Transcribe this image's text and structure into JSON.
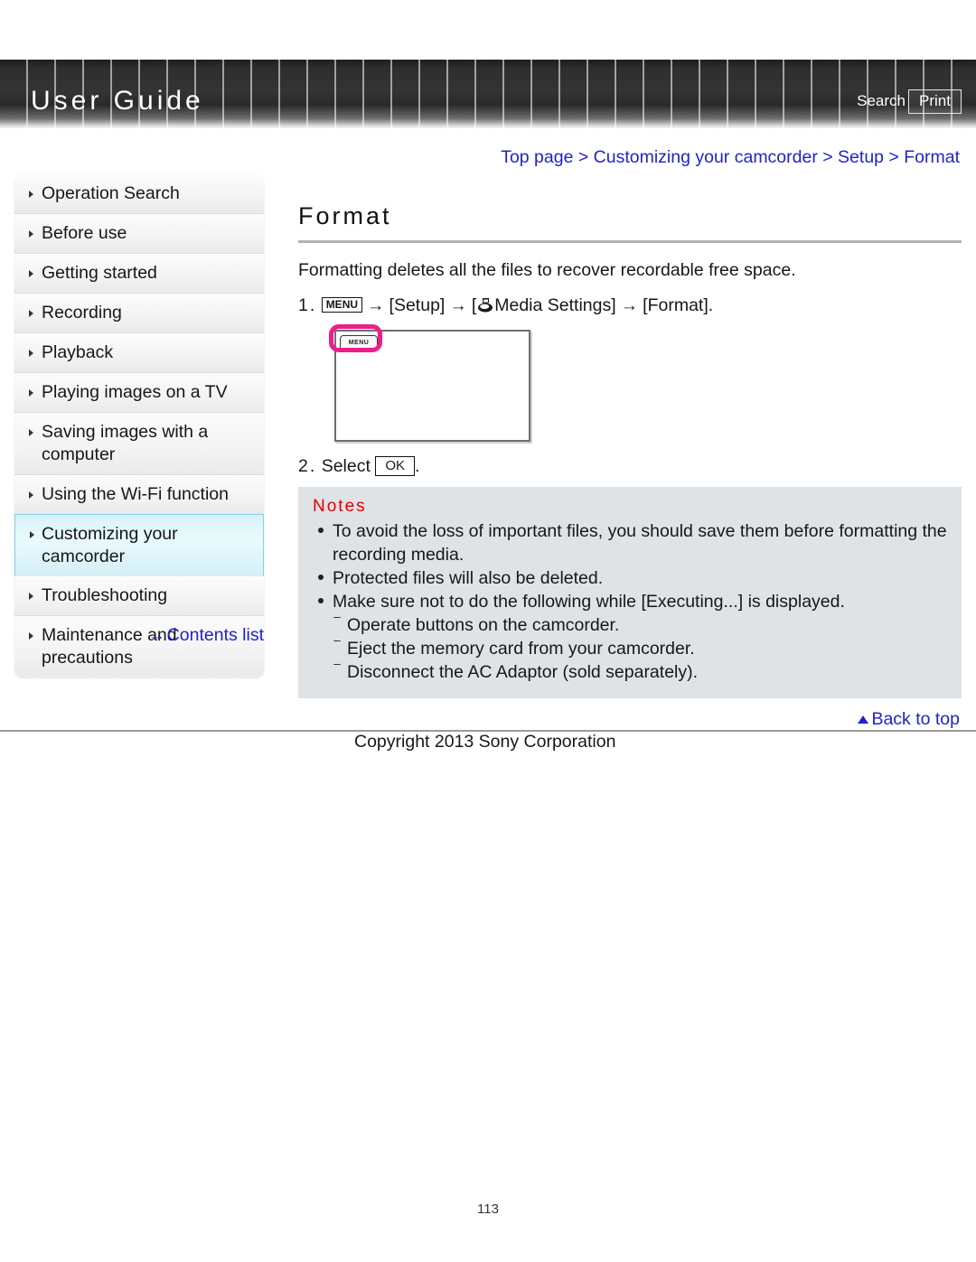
{
  "header": {
    "title": "User Guide",
    "search_label": "Search",
    "print_label": "Print"
  },
  "breadcrumb": {
    "text": "Top page > Customizing your camcorder > Setup > Format"
  },
  "sidebar": {
    "items": [
      {
        "label": "Operation Search",
        "selected": false
      },
      {
        "label": "Before use",
        "selected": false
      },
      {
        "label": "Getting started",
        "selected": false
      },
      {
        "label": "Recording",
        "selected": false
      },
      {
        "label": "Playback",
        "selected": false
      },
      {
        "label": "Playing images on a TV",
        "selected": false
      },
      {
        "label": "Saving images with a computer",
        "selected": false
      },
      {
        "label": "Using the Wi-Fi function",
        "selected": false
      },
      {
        "label": "Customizing your camcorder",
        "selected": true
      },
      {
        "label": "Troubleshooting",
        "selected": false
      },
      {
        "label": "Maintenance and precautions",
        "selected": false
      }
    ],
    "contents_link": "Contents list",
    "contents_arrow": "→"
  },
  "main": {
    "title": "Format",
    "intro": "Formatting deletes all the files to recover recordable free space.",
    "steps": [
      {
        "number": "1.",
        "menu_button": "MENU",
        "arrow": "→",
        "part_setup": "[Setup]",
        "part_media": "Media Settings]",
        "open_bracket": "[",
        "part_format": "[Format]."
      },
      {
        "number": "2.",
        "verb": "Select",
        "ok_button": "OK",
        "trailing": "."
      }
    ],
    "figure": {
      "menu_button_label": "MENU",
      "highlight_color": "#ec1e8a"
    },
    "notes": {
      "title": "Notes",
      "items": [
        "To avoid the loss of important files, you should save them before formatting the recording media.",
        "Protected files will also be deleted.",
        "Make sure not to do the following while [Executing...] is displayed."
      ],
      "sub_items": [
        "Operate buttons on the camcorder.",
        "Eject the memory card from your camcorder.",
        "Disconnect the AC Adaptor (sold separately)."
      ],
      "sub_prefix": "⁻"
    }
  },
  "footer": {
    "back_to_top": "Back to top",
    "copyright": "Copyright 2013 Sony Corporation",
    "page_number": "113"
  }
}
